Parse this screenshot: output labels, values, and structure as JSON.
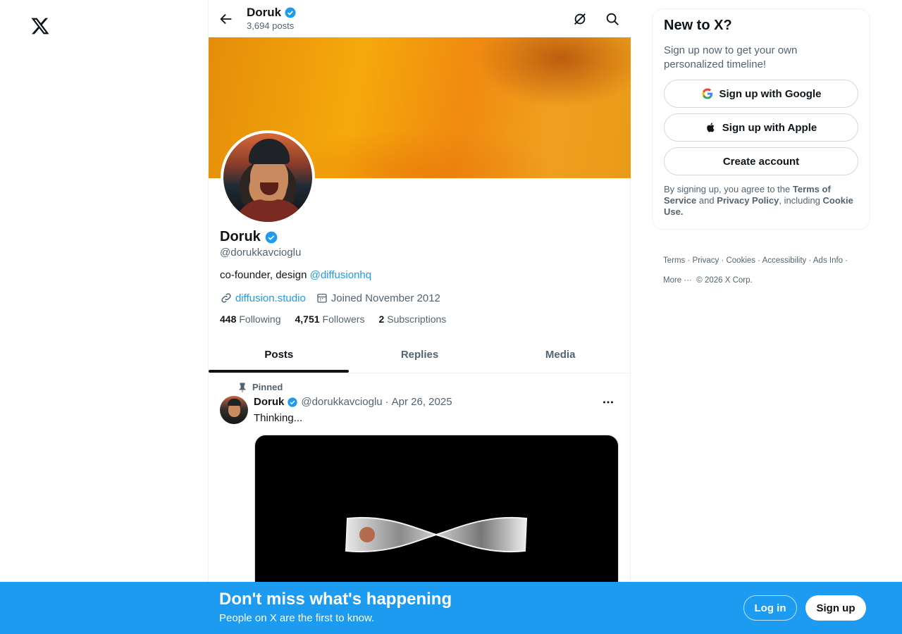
{
  "topbar": {
    "name": "Doruk",
    "posts_count": "3,694 posts"
  },
  "profile": {
    "name": "Doruk",
    "handle": "@dorukkavcioglu",
    "bio_text": "co-founder, design ",
    "bio_mention": "@diffusionhq",
    "website": "diffusion.studio",
    "joined": "Joined November 2012",
    "following_count": "448",
    "following_label": "Following",
    "followers_count": "4,751",
    "followers_label": "Followers",
    "subscriptions_count": "2",
    "subscriptions_label": "Subscriptions"
  },
  "tabs": [
    {
      "label": "Posts"
    },
    {
      "label": "Replies"
    },
    {
      "label": "Media"
    }
  ],
  "post": {
    "pinned_label": "Pinned",
    "author": "Doruk",
    "handle": "@dorukkavcioglu",
    "separator": "·",
    "date": "Apr 26, 2025",
    "text": "Thinking..."
  },
  "sidebar": {
    "title": "New to X?",
    "subtitle": "Sign up now to get your own personalized timeline!",
    "google_button": "Sign up with Google",
    "apple_button": "Sign up with Apple",
    "create_button": "Create account",
    "legal_1": "By signing up, you agree to the ",
    "legal_terms": "Terms of Service",
    "legal_2": " and ",
    "legal_privacy": "Privacy Policy",
    "legal_3": ", including ",
    "legal_cookie": "Cookie Use."
  },
  "footer": {
    "links": [
      "Terms",
      "Privacy",
      "Cookies",
      "Accessibility",
      "Ads Info",
      "More ···"
    ],
    "copyright": "© 2026 X Corp."
  },
  "bottom_bar": {
    "title": "Don't miss what's happening",
    "subtitle": "People on X are the first to know.",
    "login": "Log in",
    "signup": "Sign up"
  },
  "colors": {
    "accent": "#1d9bf0",
    "verified": "#1d9bf0",
    "text": "#0f1419",
    "muted": "#536471"
  }
}
